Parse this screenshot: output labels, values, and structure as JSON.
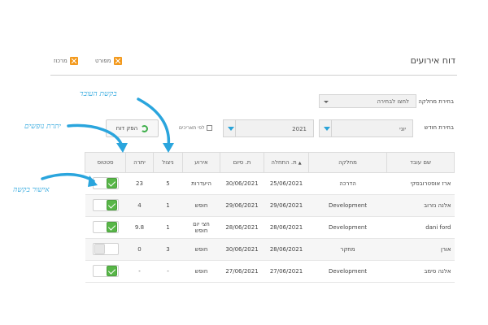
{
  "header": {
    "title": "דוח אירועים",
    "links": [
      {
        "label": "מרכוז",
        "icon": "excel-icon"
      },
      {
        "label": "מפורט",
        "icon": "excel-icon"
      }
    ]
  },
  "filters": {
    "department_label": "בחירת מחלקה",
    "department_placeholder": "לחצו לבחירה",
    "month_label": "בחירת חודש",
    "month_value": "יוני",
    "year_value": "2021",
    "by_dates_label": "לפי תאריכים",
    "generate_button": "הפק דוח"
  },
  "table": {
    "headers": [
      "שם עובד",
      "מחלקה",
      "ת. התחלה",
      "ת. סיום",
      "אירוע",
      "ניצול",
      "יתרה",
      "סטטוס"
    ],
    "rows": [
      {
        "name": "ארז אוסטרובסקי",
        "dept": "הדרכה",
        "start": "25/06/2021",
        "end": "30/06/2021",
        "event": "היעדרות",
        "used": "5",
        "balance": "23",
        "status": true
      },
      {
        "name": "אלנה נזרוב",
        "dept": "Development",
        "start": "29/06/2021",
        "end": "29/06/2021",
        "event": "חופש",
        "used": "1",
        "balance": "4",
        "status": true
      },
      {
        "name": "dani ford",
        "dept": "Development",
        "start": "28/06/2021",
        "end": "28/06/2021",
        "event": "חצי יום חופש",
        "used": "1",
        "balance": "9.8",
        "status": true
      },
      {
        "name": "אורן",
        "dept": "מחקר",
        "start": "28/06/2021",
        "end": "30/06/2021",
        "event": "חופש",
        "used": "3",
        "balance": "0",
        "status": false
      },
      {
        "name": "אלנה סימב",
        "dept": "Development",
        "start": "27/06/2021",
        "end": "27/06/2021",
        "event": "חופש",
        "used": "-",
        "balance": "-",
        "status": true
      }
    ]
  },
  "annotations": {
    "employee_request": "בקשת העובד",
    "vacation_balance": "יתרת נופשים",
    "request_approval": "אישור בקשה"
  },
  "colors": {
    "accent": "#2aa5dd",
    "approved": "#58b648",
    "excel": "#f39a1e"
  }
}
